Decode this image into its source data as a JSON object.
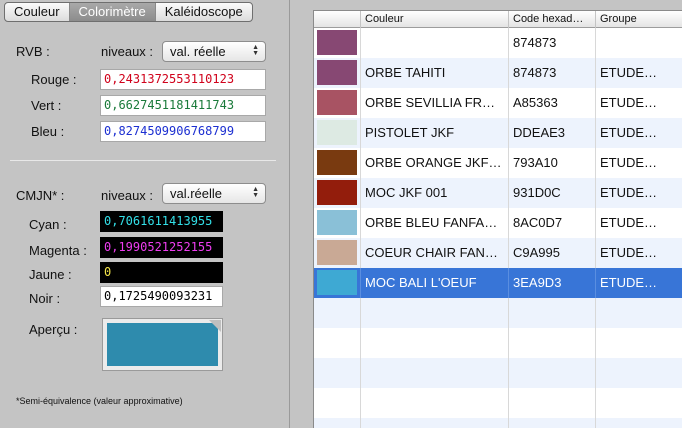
{
  "tabs": [
    "Couleur",
    "Colorimètre",
    "Kaléidoscope"
  ],
  "rvb": {
    "label": "RVB :",
    "niveaux_label": "niveaux :",
    "mode": "val. réelle",
    "rouge_label": "Rouge :",
    "rouge": "0,2431372553110123",
    "vert_label": "Vert :",
    "vert": "0,6627451181411743",
    "bleu_label": "Bleu :",
    "bleu": "0,8274509906768799"
  },
  "cmjn": {
    "label": "CMJN* :",
    "niveaux_label": "niveaux :",
    "mode": "val.réelle",
    "cyan_label": "Cyan :",
    "cyan": "0,7061611413955",
    "magenta_label": "Magenta :",
    "magenta": "0,1990521252155",
    "jaune_label": "Jaune :",
    "jaune": "0",
    "noir_label": "Noir :",
    "noir": "0,1725490093231"
  },
  "apercu_label": "Aperçu :",
  "apercu_color": "#2e8bad",
  "note": "*Semi-équivalence (valeur approximative)",
  "table": {
    "headers": [
      "",
      "Couleur",
      "Code hexad…",
      "Groupe"
    ],
    "rows": [
      {
        "color": "#874873",
        "name": "",
        "code": "874873",
        "group": ""
      },
      {
        "color": "#874873",
        "name": "ORBE TAHITI",
        "code": "874873",
        "group": "ETUDE…"
      },
      {
        "color": "#A85363",
        "name": "ORBE SEVILLIA FR…",
        "code": "A85363",
        "group": "ETUDE…"
      },
      {
        "color": "#DDEAE3",
        "name": "PISTOLET JKF",
        "code": "DDEAE3",
        "group": "ETUDE…"
      },
      {
        "color": "#793A10",
        "name": "ORBE ORANGE JKF…",
        "code": "793A10",
        "group": "ETUDE…"
      },
      {
        "color": "#931D0C",
        "name": "MOC JKF 001",
        "code": "931D0C",
        "group": "ETUDE…"
      },
      {
        "color": "#8AC0D7",
        "name": "ORBE BLEU FANFA…",
        "code": "8AC0D7",
        "group": "ETUDE…"
      },
      {
        "color": "#C9A995",
        "name": "COEUR CHAIR FAN…",
        "code": "C9A995",
        "group": "ETUDE…"
      },
      {
        "color": "#3EA9D3",
        "name": "MOC BALI L'OEUF",
        "code": "3EA9D3",
        "group": "ETUDE…"
      }
    ],
    "selected_index": 8
  }
}
